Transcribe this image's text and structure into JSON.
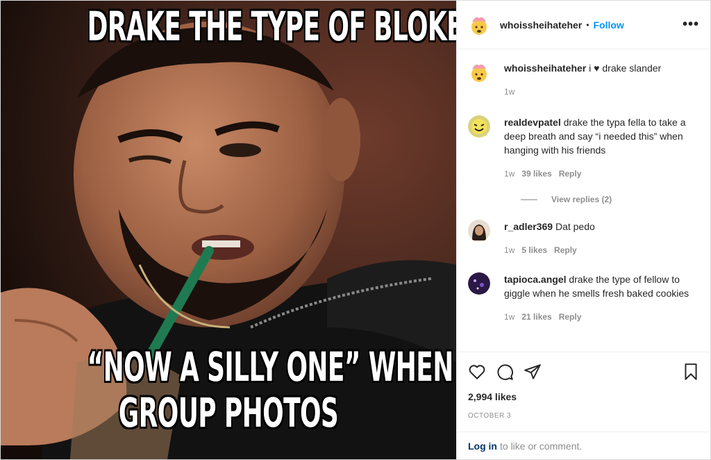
{
  "post": {
    "author": "whoissheihateher",
    "follow_label": "Follow",
    "dot": "•",
    "more_label": "•••",
    "meme_top": "DRAKE THE TYPE OF BLOKE TO SAY",
    "meme_bottom_line1": "“NOW A SILLY ONE” WHEN TAKING",
    "meme_bottom_line2": "GROUP PHOTOS"
  },
  "caption": {
    "user": "whoissheihateher",
    "text_before": "i",
    "heart": "♥",
    "text_after": "drake slander",
    "time": "1w"
  },
  "comments": [
    {
      "user": "realdevpatel",
      "text": "drake the typa fella to take a deep breath and say “i needed this” when hanging with his friends",
      "time": "1w",
      "likes": "39 likes",
      "reply": "Reply"
    },
    {
      "user": "r_adler369",
      "text": "Dat pedo",
      "time": "1w",
      "likes": "5 likes",
      "reply": "Reply"
    },
    {
      "user": "tapioca.angel",
      "text": "drake the type of fellow to giggle when he smells fresh baked cookies",
      "time": "1w",
      "likes": "21 likes",
      "reply": "Reply"
    }
  ],
  "view_replies": "View replies (2)",
  "likes_count": "2,994 likes",
  "date": "OCTOBER 3",
  "login": {
    "link": "Log in",
    "rest": "to like or comment."
  },
  "icons": [
    "heart-icon",
    "comment-icon",
    "share-icon",
    "bookmark-icon"
  ],
  "colors": {
    "link": "#0095f6",
    "muted": "#8e8e8e",
    "text": "#262626"
  }
}
